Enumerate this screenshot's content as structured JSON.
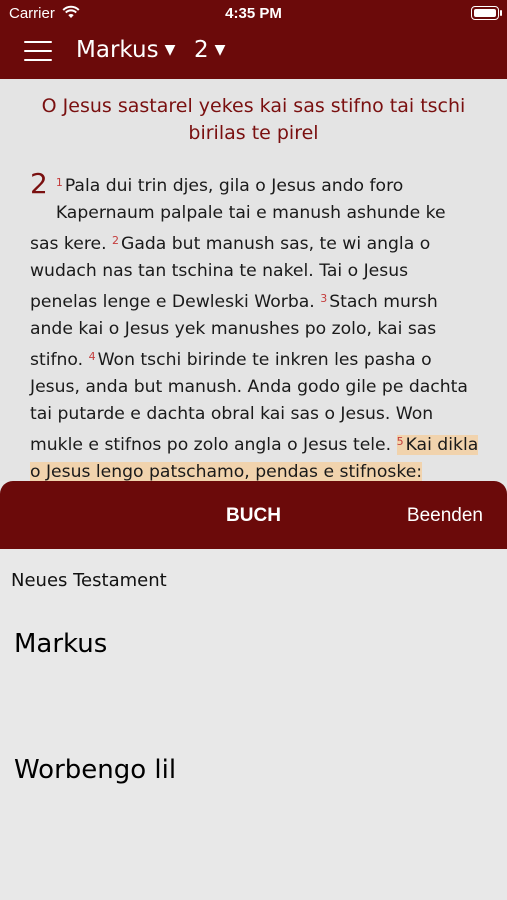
{
  "status": {
    "carrier": "Carrier",
    "time": "4:35 PM"
  },
  "nav": {
    "book": "Markus",
    "chapter": "2"
  },
  "reader": {
    "heading": "O Jesus sastarel yekes kai sas stifno tai tschi birilas te pirel",
    "chapter_number": "2",
    "verses": [
      {
        "n": "1",
        "text": "Pala dui trin djes, gila o Jesus ando foro Kapernaum palpale tai e manush ashunde ke sas kere."
      },
      {
        "n": "2",
        "text": "Gada but manush sas, te wi angla o wudach nas tan tschina te nakel. Tai o Jesus penelas lenge e Dewleski Worba."
      },
      {
        "n": "3",
        "text": "Stach mursh ande kai o Jesus yek manushes po zolo, kai sas stifno."
      },
      {
        "n": "4",
        "text": "Won tschi birinde te inkren les pasha o Jesus, anda but manush. Anda godo gile pe dachta tai putarde e dachta obral kai sas o Jesus. Won mukle e stifnos po zolo angla o Jesus tele."
      },
      {
        "n": "5",
        "text": "Kai dikla o Jesus lengo patschamo, pendas e stifnoske: «Muro shaf, tschire besecha si tuke"
      }
    ]
  },
  "sheet": {
    "title": "BUCH",
    "done": "Beenden",
    "section": "Neues Testament",
    "books": [
      "Markus",
      "Worbengo lil"
    ]
  }
}
